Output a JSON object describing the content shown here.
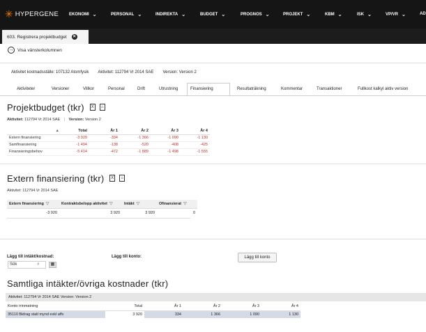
{
  "app": {
    "logo_text": "HYPERGENE",
    "nav": [
      "EKONOMI",
      "PERSONAL",
      "INDIREKTA",
      "BUDGET",
      "PROGNOS",
      "PROJEKT",
      "KBM",
      "ISK",
      "VP/VR",
      "AD"
    ]
  },
  "doc_tab": {
    "label": "603. Registrera projektbudget",
    "close": "✕"
  },
  "show_left": "Visa vänsterkolumnen",
  "info": {
    "cost_center": "Aktivitet kostnadsställe: 107132 Atomfysik",
    "activity": "Aktivitet: 112794 Vr 2014 SAE",
    "version": "Version: Version 2"
  },
  "subtabs": [
    "Aktiviteter",
    "Versioner",
    "Villkor",
    "Personal",
    "Drift",
    "Utrustning",
    "Finansiering",
    "Resultaträkning",
    "Kommentar",
    "Transaktioner",
    "Fullkost kalkyl aktiv version"
  ],
  "active_subtab": "Finansiering",
  "projektbudget": {
    "title": "Projektbudget (tkr)",
    "meta_activity_label": "Aktivitet:",
    "meta_activity_value": "112794 Vr 2014 SAE",
    "meta_version_label": "Version:",
    "meta_version_value": "Version 2",
    "columns": [
      "Total",
      "År 1",
      "År 2",
      "År 3",
      "År 4"
    ],
    "rows": [
      {
        "label": "Extern finansiering",
        "values": [
          "-3 920",
          "-334",
          "-1 366",
          "-1 090",
          "-1 130"
        ]
      },
      {
        "label": "Samfinansiering",
        "values": [
          "-1 494",
          "-138",
          "-520",
          "-408",
          "-425"
        ]
      },
      {
        "label": "Finansieringsbehov",
        "values": [
          "-5 414",
          "-472",
          "-1 889",
          "-1 498",
          "-1 555"
        ]
      }
    ]
  },
  "extern": {
    "title": "Extern finansiering (tkr)",
    "meta": "Aktivitet: 112794 Vr 2014 SAE",
    "columns": [
      "Extern finansiering",
      "Kontraktsbelopp aktivitet",
      "Intäkt",
      "Ofinansierat"
    ],
    "row": [
      "-3 920",
      "3 920",
      "3 920",
      "0"
    ]
  },
  "form": {
    "add_income_label": "Lägg till intäkt/kostnad:",
    "search_placeholder": "Sök",
    "add_account_label": "Lägg till konto:",
    "add_account_button": "Lägg till konto"
  },
  "all": {
    "title": "Samtliga intäkter/övriga kostnader (tkr)",
    "header": "Aktivitet: 112794 Vr 2014 SAE Version: Version 2",
    "columns": [
      "Konto rrinmatning",
      "Total",
      "År 1",
      "År 2",
      "År 3",
      "År 4"
    ],
    "row": [
      "35110 Bidrag statl mynd exkl affv",
      "3 920",
      "334",
      "1 366",
      "1 090",
      "1 130"
    ]
  }
}
